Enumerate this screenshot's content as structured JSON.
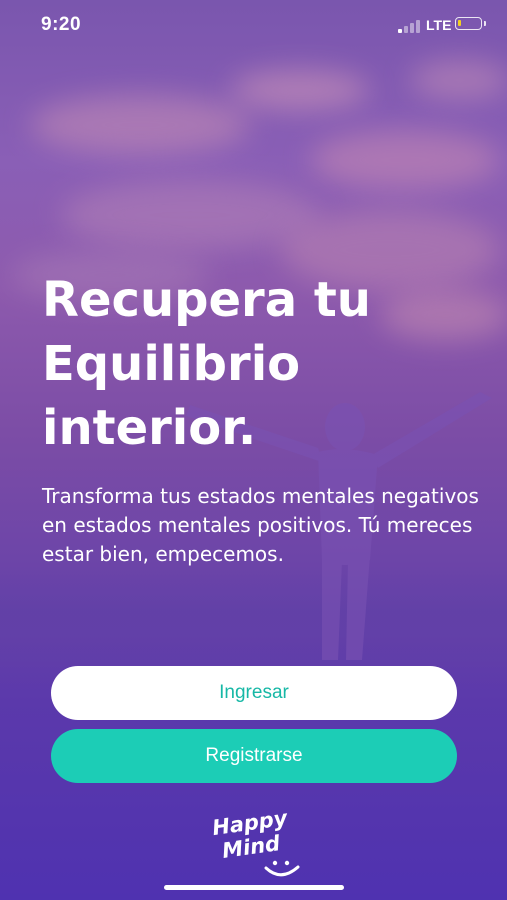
{
  "status_bar": {
    "time": "9:20",
    "network": "LTE",
    "signal_bars": 4,
    "signal_bars_active": 1,
    "battery_level": 0.15,
    "battery_color": "#f2d11e"
  },
  "hero": {
    "headline_lines": [
      "Recupera tu",
      "Equilibrio",
      "interior."
    ],
    "subtitle": "Transforma tus estados mentales negativos en estados mentales positivos. Tú mereces estar bien, empecemos."
  },
  "actions": {
    "login_label": "Ingresar",
    "register_label": "Registrarse"
  },
  "logo": {
    "line1": "Happy",
    "line2": "Mind",
    "icon": "smile-icon"
  },
  "colors": {
    "accent": "#1ccdb6",
    "accent_text": "#17b8a6",
    "background_top": "#7a56ae",
    "background_bottom": "#4f32b0"
  }
}
